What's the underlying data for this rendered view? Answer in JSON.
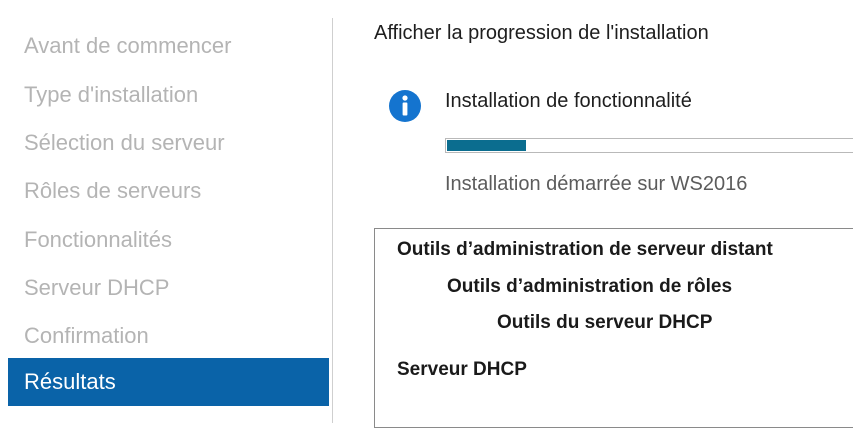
{
  "sidebar": {
    "items": [
      {
        "label": "Avant de commencer",
        "active": false
      },
      {
        "label": "Type d'installation",
        "active": false
      },
      {
        "label": "Sélection du serveur",
        "active": false
      },
      {
        "label": "Rôles de serveurs",
        "active": false
      },
      {
        "label": "Fonctionnalités",
        "active": false
      },
      {
        "label": "Serveur DHCP",
        "active": false
      },
      {
        "label": "Confirmation",
        "active": false
      },
      {
        "label": "Résultats",
        "active": true
      }
    ],
    "active_color": "#0a63a8"
  },
  "main": {
    "title": "Afficher la progression de l'installation",
    "status": {
      "icon": "info-icon",
      "title": "Installation de fonctionnalité",
      "progress": 0.19,
      "progress_color": "#0b6d8f",
      "subtitle": "Installation démarrée sur WS2016"
    },
    "results": [
      "Outils d’administration de serveur distant",
      "Outils d’administration de rôles",
      "Outils du serveur DHCP",
      "Serveur DHCP"
    ]
  }
}
